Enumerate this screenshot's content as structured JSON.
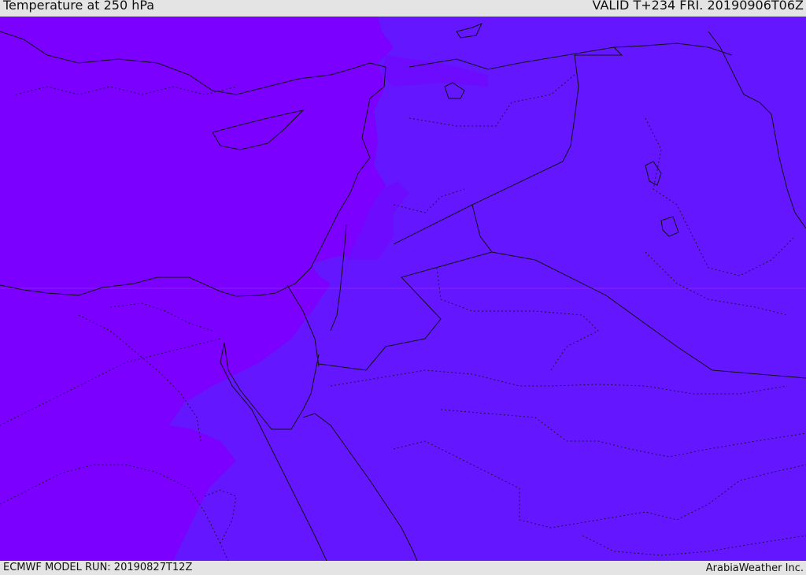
{
  "header": {
    "title": "Temperature at 250 hPa",
    "valid": "VALID T+234 FRI. 20190906T06Z"
  },
  "footer": {
    "model_run": "ECMWF MODEL RUN: 20190827T12Z",
    "credit": "ArabiaWeather Inc."
  },
  "colors": {
    "warm_zone": "#7b00ff",
    "mid_zone": "#6d0bff",
    "cool_zone": "#6417ff",
    "border_line": "#111111"
  }
}
